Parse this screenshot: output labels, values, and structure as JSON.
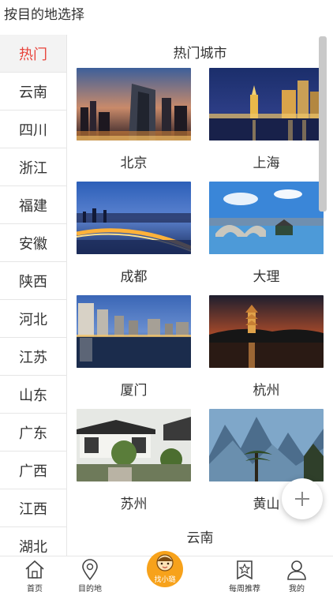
{
  "header": {
    "title": "按目的地选择"
  },
  "sidebar": {
    "items": [
      {
        "label": "热门",
        "active": true
      },
      {
        "label": "云南"
      },
      {
        "label": "四川"
      },
      {
        "label": "浙江"
      },
      {
        "label": "福建"
      },
      {
        "label": "安徽"
      },
      {
        "label": "陕西"
      },
      {
        "label": "河北"
      },
      {
        "label": "江苏"
      },
      {
        "label": "山东"
      },
      {
        "label": "广东"
      },
      {
        "label": "广西"
      },
      {
        "label": "江西"
      },
      {
        "label": "湖北"
      }
    ]
  },
  "main": {
    "section_title": "热门城市",
    "cities": [
      {
        "name": "北京",
        "photo": "night-skyline-photo"
      },
      {
        "name": "上海",
        "photo": "bund-night-photo"
      },
      {
        "name": "成都",
        "photo": "city-bridge-lights-photo"
      },
      {
        "name": "大理",
        "photo": "stone-bridge-lake-photo"
      },
      {
        "name": "厦门",
        "photo": "waterfront-towers-photo"
      },
      {
        "name": "杭州",
        "photo": "pagoda-sunset-photo"
      },
      {
        "name": "苏州",
        "photo": "classical-garden-photo"
      },
      {
        "name": "黄山",
        "photo": "mountain-pine-photo"
      }
    ],
    "next_section_title": "云南"
  },
  "fab": {
    "icon": "plus-icon"
  },
  "tabbar": {
    "tabs": [
      {
        "label": "首页",
        "icon": "home-icon"
      },
      {
        "label": "目的地",
        "icon": "location-pin-icon"
      },
      {
        "label": "找小璐",
        "icon": "mascot-face-icon"
      },
      {
        "label": "每周推荐",
        "icon": "star-badge-icon"
      },
      {
        "label": "我的",
        "icon": "user-icon"
      }
    ]
  },
  "colors": {
    "active_text": "#e8423a",
    "accent_orange": "#f7a21b",
    "divider": "#e6e6e6",
    "active_bg": "#f3f3f3"
  }
}
